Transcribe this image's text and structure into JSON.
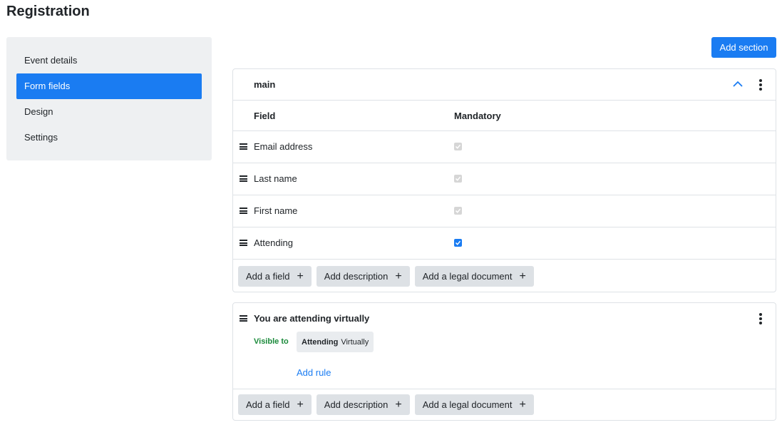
{
  "page": {
    "title": "Registration"
  },
  "sidebar": {
    "items": [
      {
        "label": "Event details",
        "active": false
      },
      {
        "label": "Form fields",
        "active": true
      },
      {
        "label": "Design",
        "active": false
      },
      {
        "label": "Settings",
        "active": false
      }
    ]
  },
  "toolbar": {
    "add_section_label": "Add section"
  },
  "main_section": {
    "title": "main",
    "columns": {
      "field": "Field",
      "mandatory": "Mandatory"
    },
    "rows": [
      {
        "label": "Email address",
        "mandatory": true,
        "locked": true
      },
      {
        "label": "Last name",
        "mandatory": true,
        "locked": true
      },
      {
        "label": "First name",
        "mandatory": true,
        "locked": true
      },
      {
        "label": "Attending",
        "mandatory": true,
        "locked": false
      }
    ],
    "actions": {
      "add_field": "Add a field",
      "add_description": "Add description",
      "add_legal": "Add a legal document",
      "plus": "+"
    }
  },
  "virtual_section": {
    "title": "You are attending virtually",
    "visible_to_label": "Visible to",
    "rule": {
      "field": "Attending",
      "value": "Virtually"
    },
    "add_rule_label": "Add rule",
    "actions": {
      "add_field": "Add a field",
      "add_description": "Add description",
      "add_legal": "Add a legal document",
      "plus": "+"
    }
  },
  "colors": {
    "accent": "#1a7cf2",
    "visible_green": "#1a8a3a",
    "sidebar_bg": "#eef0f2",
    "pill_bg": "#dde1e5"
  },
  "icons": {
    "collapse": "chevron-up-icon",
    "menu": "kebab-menu-icon",
    "drag": "drag-handle-icon",
    "add": "plus-icon"
  }
}
